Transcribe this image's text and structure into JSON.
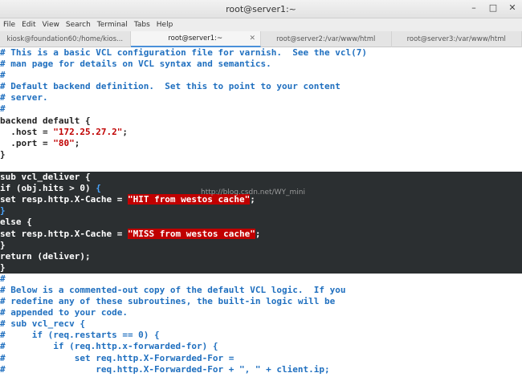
{
  "window": {
    "title": "root@server1:~",
    "controls": [
      "–",
      "□",
      "✕"
    ]
  },
  "menu": [
    "File",
    "Edit",
    "View",
    "Search",
    "Terminal",
    "Tabs",
    "Help"
  ],
  "tabs": [
    {
      "label": "kiosk@foundation60:/home/kios...",
      "active": false
    },
    {
      "label": "root@server1:~",
      "active": true
    },
    {
      "label": "root@server2:/var/www/html",
      "active": false
    },
    {
      "label": "root@server3:/var/www/html",
      "active": false
    }
  ],
  "watermark": "http://blog.csdn.net/WY_mini",
  "lines": [
    {
      "t": "# This is a basic VCL configuration file for varnish.  See the vcl(7)",
      "k": "cmt"
    },
    {
      "t": "# man page for details on VCL syntax and semantics.",
      "k": "cmt"
    },
    {
      "t": "#",
      "k": "cmt"
    },
    {
      "t": "# Default backend definition.  Set this to point to your content",
      "k": "cmt"
    },
    {
      "t": "# server.",
      "k": "cmt"
    },
    {
      "t": "#",
      "k": "cmt"
    },
    {
      "t": "backend default {",
      "k": "code"
    },
    {
      "t": "  .host = ",
      "s": "\"172.25.27.2\"",
      "e": ";",
      "k": "code"
    },
    {
      "t": "  .port = ",
      "s": "\"80\"",
      "e": ";",
      "k": "code"
    },
    {
      "t": "}",
      "k": "code"
    },
    {
      "t": "",
      "k": "code"
    },
    {
      "t": "sub vcl_deliver {",
      "k": "hl"
    },
    {
      "t": "if (obj.hits > 0) ",
      "b": "{",
      "k": "hl"
    },
    {
      "t": "set resp.http.X-Cache = ",
      "sh": "\"HIT from westos cache\"",
      "e": ";",
      "k": "hl"
    },
    {
      "t": "",
      "b": "}",
      "k": "hl"
    },
    {
      "t": "else {",
      "k": "hl"
    },
    {
      "t": "set resp.http.X-Cache = ",
      "sh": "\"MISS from westos cache\"",
      "e": ";",
      "k": "hl"
    },
    {
      "t": "}",
      "k": "hl"
    },
    {
      "t": "return (deliver);",
      "k": "hl"
    },
    {
      "t": "}",
      "k": "hl"
    },
    {
      "t": "#",
      "k": "cmt"
    },
    {
      "t": "# Below is a commented-out copy of the default VCL logic.  If you",
      "k": "cmt"
    },
    {
      "t": "# redefine any of these subroutines, the built-in logic will be",
      "k": "cmt"
    },
    {
      "t": "# appended to your code.",
      "k": "cmt"
    },
    {
      "t": "# sub vcl_recv {",
      "k": "cmt"
    },
    {
      "t": "#     if (req.restarts == 0) {",
      "k": "cmt"
    },
    {
      "t": "#         if (req.http.x-forwarded-for) {",
      "k": "cmt"
    },
    {
      "t": "#             set req.http.X-Forwarded-For =",
      "k": "cmt"
    },
    {
      "t": "#                 req.http.X-Forwarded-For + \", \" + client.ip;",
      "k": "cmt"
    }
  ]
}
